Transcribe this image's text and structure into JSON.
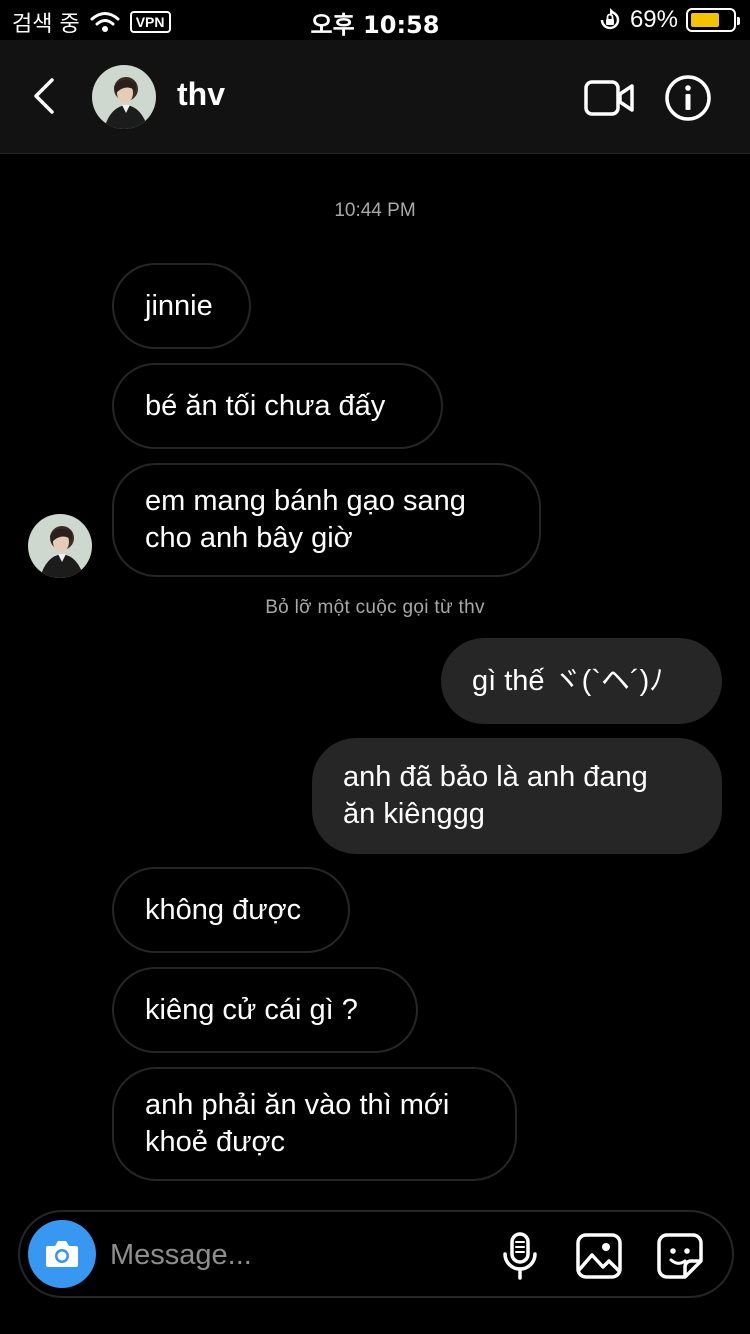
{
  "status_bar": {
    "carrier": "검색 중",
    "vpn": "VPN",
    "time": "오후 10:58",
    "battery": "69%",
    "battery_level": 0.69
  },
  "header": {
    "name": "thv"
  },
  "chat": {
    "timestamp": "10:44 PM",
    "messages": [
      {
        "text": "jinnie"
      },
      {
        "text": "bé ăn tối chưa đấy"
      },
      {
        "text": "em mang bánh gạo sang\ncho anh bây giờ"
      },
      {
        "text": "gì thế ヾ(`ヘ´)ﾉ"
      },
      {
        "text": "anh đã bảo là anh đang\năn kiênggg"
      },
      {
        "text": "không được"
      },
      {
        "text": "kiêng cử cái gì ?"
      },
      {
        "text": "anh phải ăn vào thì mới\nkhoẻ được"
      }
    ],
    "missed_call": "Bỏ lỡ một cuộc gọi từ thv"
  },
  "composer": {
    "placeholder": "Message..."
  },
  "colors": {
    "accent": "#3897f0",
    "battery": "#f5c400",
    "bubble_out": "#262626",
    "bubble_border": "#262626"
  }
}
